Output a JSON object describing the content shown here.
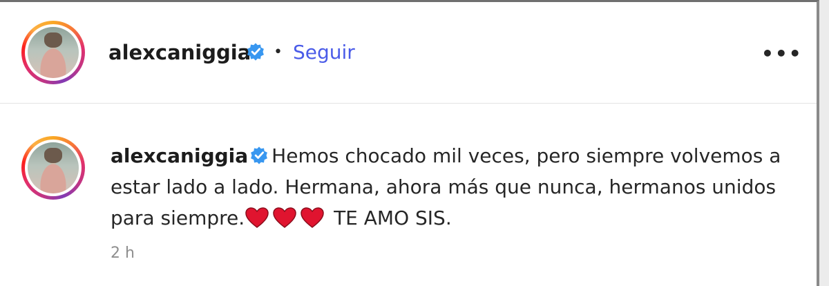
{
  "post_header": {
    "username": "alexcaniggia",
    "separator": "•",
    "follow_label": "Seguir",
    "more_label": "•••"
  },
  "comment": {
    "username": "alexcaniggia",
    "text_before": "Hemos chocado mil veces, pero siempre volvemos a estar lado a lado. Hermana, ahora más que nunca, hermanos unidos para siempre.",
    "hearts": [
      "heart-icon",
      "heart-icon",
      "heart-icon"
    ],
    "text_after": "TE AMO SIS.",
    "time": "2 h"
  },
  "colors": {
    "follow": "#4a5be8",
    "verified": "#3897f0",
    "heart": "#e0142f"
  }
}
